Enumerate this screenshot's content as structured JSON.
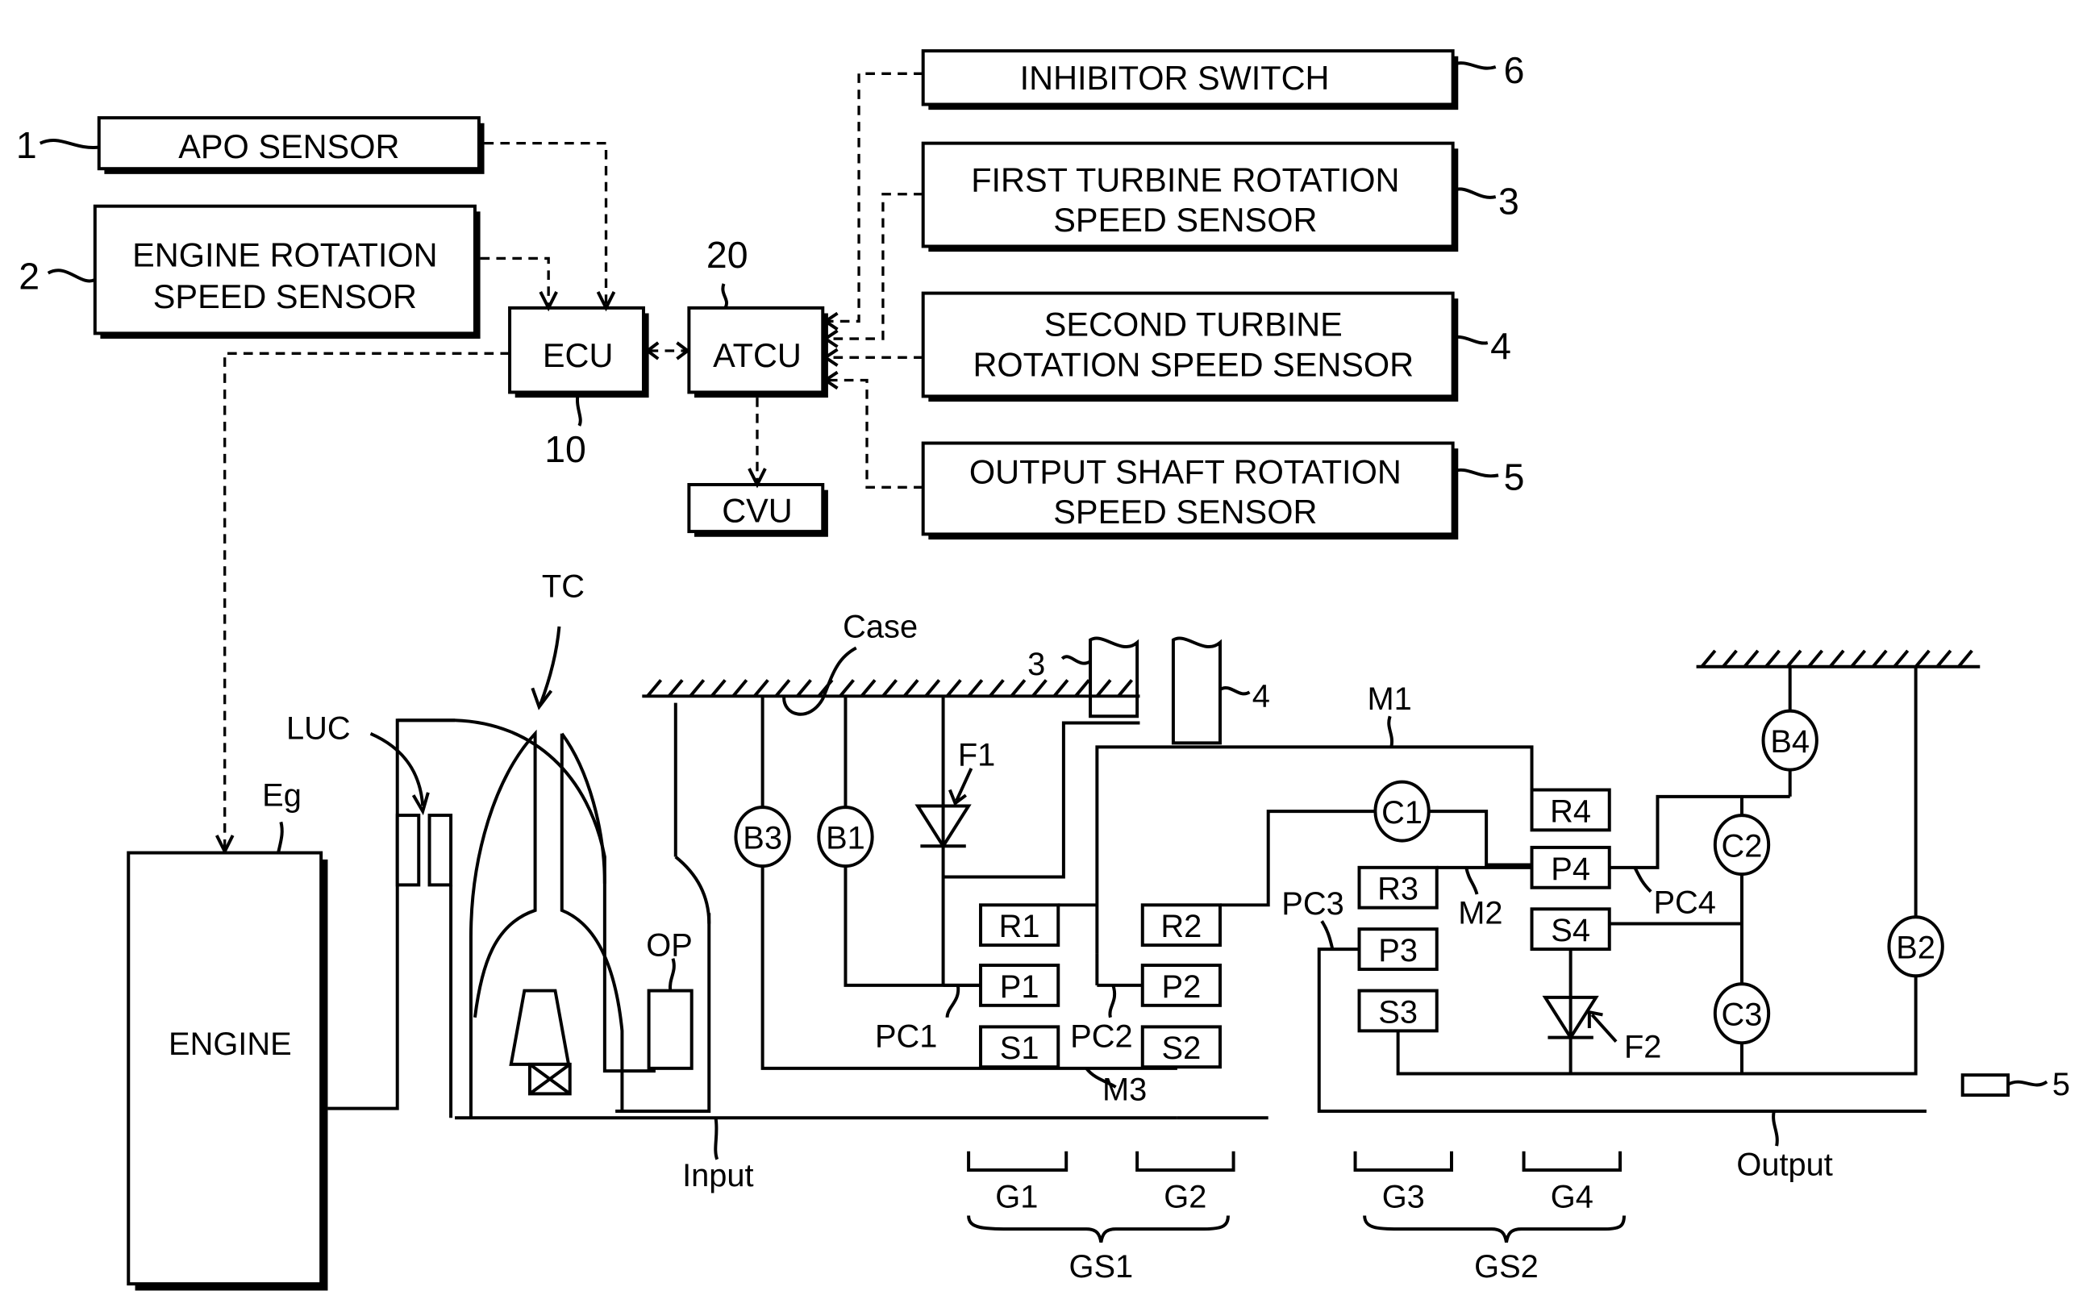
{
  "diagram": {
    "control_blocks": {
      "apo_sensor": {
        "label": "APO SENSOR",
        "ref": "1"
      },
      "engine_speed_sensor": {
        "line1": "ENGINE ROTATION",
        "line2": "SPEED SENSOR",
        "ref": "2"
      },
      "ecu": {
        "label": "ECU",
        "ref": "10"
      },
      "atcu": {
        "label": "ATCU",
        "ref": "20"
      },
      "cvu": {
        "label": "CVU"
      },
      "inhibitor_switch": {
        "label": "INHIBITOR SWITCH",
        "ref": "6"
      },
      "first_turbine_sensor": {
        "line1": "FIRST TURBINE ROTATION",
        "line2": "SPEED SENSOR",
        "ref": "3"
      },
      "second_turbine_sensor": {
        "line1": "SECOND TURBINE",
        "line2": "ROTATION SPEED SENSOR",
        "ref": "4"
      },
      "output_shaft_sensor": {
        "line1": "OUTPUT SHAFT ROTATION",
        "line2": "SPEED SENSOR",
        "ref": "5"
      }
    },
    "mechanical": {
      "engine": {
        "label": "ENGINE",
        "ref": "Eg"
      },
      "torque_converter": "TC",
      "lockup_clutch": "LUC",
      "oil_pump": "OP",
      "case": "Case",
      "input": "Input",
      "output": "Output",
      "sensor3_ref": "3",
      "sensor4_ref": "4",
      "sensor5_ref": "5",
      "brakes": [
        "B1",
        "B2",
        "B3",
        "B4"
      ],
      "clutches": [
        "C1",
        "C2",
        "C3"
      ],
      "one_way_clutches": [
        "F1",
        "F2"
      ],
      "members": [
        "M1",
        "M2",
        "M3"
      ],
      "carriers": [
        "PC1",
        "PC2",
        "PC3",
        "PC4"
      ],
      "gear_set_1": {
        "ring": "R1",
        "pinion": "P1",
        "sun": "S1"
      },
      "gear_set_2": {
        "ring": "R2",
        "pinion": "P2",
        "sun": "S2"
      },
      "gear_set_3": {
        "ring": "R3",
        "pinion": "P3",
        "sun": "S3"
      },
      "gear_set_4": {
        "ring": "R4",
        "pinion": "P4",
        "sun": "S4"
      },
      "groups": [
        "G1",
        "G2",
        "G3",
        "G4"
      ],
      "gear_sets": [
        "GS1",
        "GS2"
      ]
    }
  }
}
